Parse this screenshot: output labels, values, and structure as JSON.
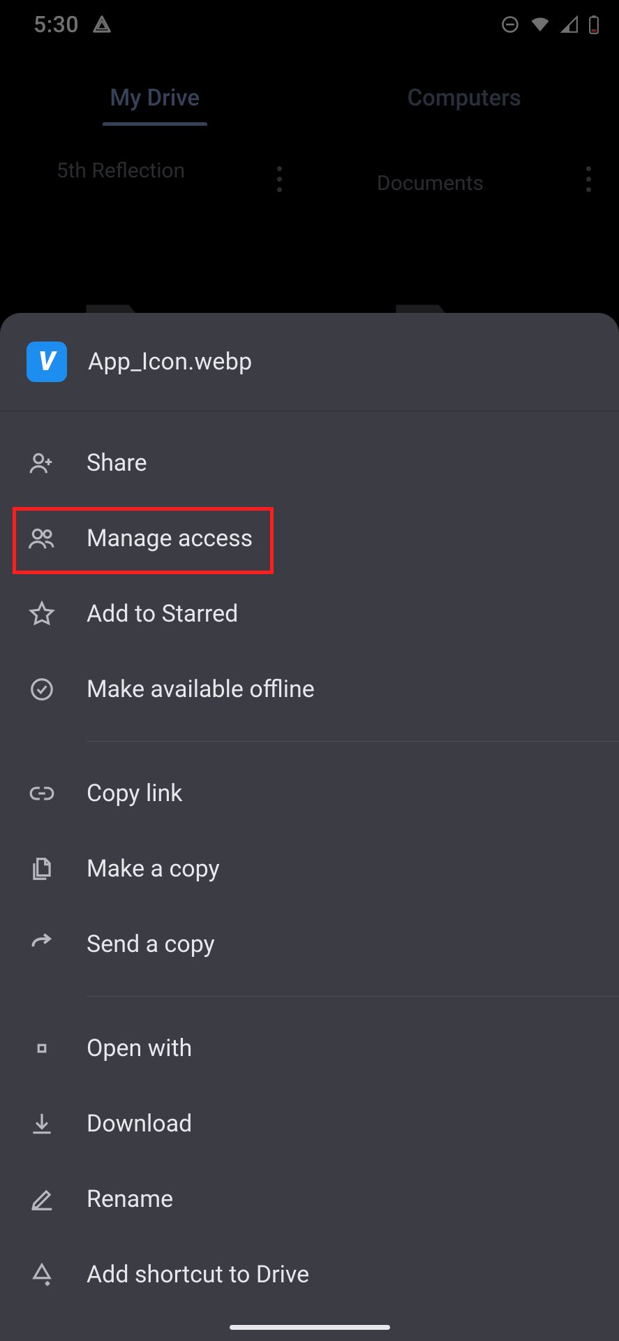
{
  "status_bar": {
    "time": "5:30"
  },
  "tabs": {
    "my_drive": "My Drive",
    "computers": "Computers"
  },
  "background": {
    "item1": "5th Reflection",
    "item2": "Documents"
  },
  "sheet": {
    "filename": "App_Icon.webp",
    "icon_letter": "V",
    "menu": {
      "share": "Share",
      "manage_access": "Manage access",
      "add_starred": "Add to Starred",
      "available_offline": "Make available offline",
      "copy_link": "Copy link",
      "make_copy": "Make a copy",
      "send_copy": "Send a copy",
      "open_with": "Open with",
      "download": "Download",
      "rename": "Rename",
      "add_shortcut": "Add shortcut to Drive"
    }
  }
}
